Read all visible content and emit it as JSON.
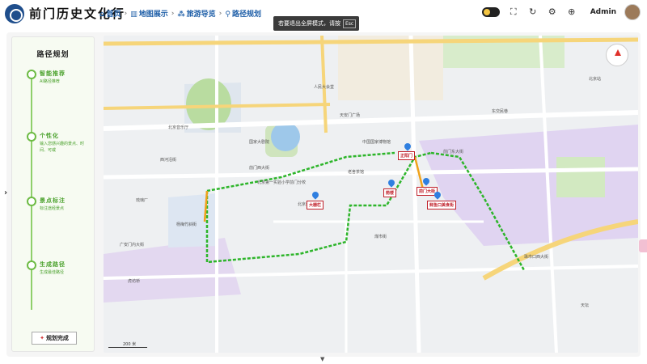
{
  "app": {
    "title": "前门历史文化行"
  },
  "breadcrumb": [
    {
      "label": "首页",
      "icon": "home-icon",
      "glyph": "⌂"
    },
    {
      "label": "地图展示",
      "icon": "map-icon",
      "glyph": "▥"
    },
    {
      "label": "旅游导览",
      "icon": "tour-icon",
      "glyph": "⁂"
    },
    {
      "label": "路径规划",
      "icon": "route-pin-icon",
      "glyph": "⚲"
    }
  ],
  "fullscreen_tip": {
    "text": "若要退出全屏模式，请按",
    "key": "Esc"
  },
  "user": {
    "name": "Admin"
  },
  "panel": {
    "title": "路径规划",
    "steps": [
      {
        "label": "智能推荐",
        "desc": "AI路径推荐"
      },
      {
        "label": "个性化",
        "desc": "输入您感兴趣的景点、时间、可或"
      },
      {
        "label": "景点标注",
        "desc": "标注途经景点"
      },
      {
        "label": "生成路径",
        "desc": "生成最佳路径"
      }
    ],
    "done_label": "规划完成",
    "done_icon": "celebrate-icon"
  },
  "map": {
    "scale_label": "200 米",
    "pois": [
      {
        "label": "大栅栏"
      },
      {
        "label": "正阳门"
      },
      {
        "label": "前门大街"
      },
      {
        "label": "箭楼"
      },
      {
        "label": "鲜鱼口美食街"
      }
    ],
    "labels": [
      "人民大会堂",
      "中国国家博物馆",
      "天安门广场",
      "北京音乐厅",
      "前门东大街",
      "前门西大街",
      "东交民巷",
      "国家大剧院",
      "北京坊",
      "杨梅竹斜街",
      "珠市口西大街",
      "天坛",
      "琉璃厂",
      "虎坊桥",
      "广安门内大街",
      "老舍茶馆",
      "北京第一实验小学前门分校",
      "煤市街",
      "西河沿街",
      "北京站"
    ]
  },
  "colors": {
    "route": "#2db52a",
    "route_alt": "#f0a21b",
    "accent": "#1f5fa8",
    "panel_green": "#4aa12c"
  }
}
